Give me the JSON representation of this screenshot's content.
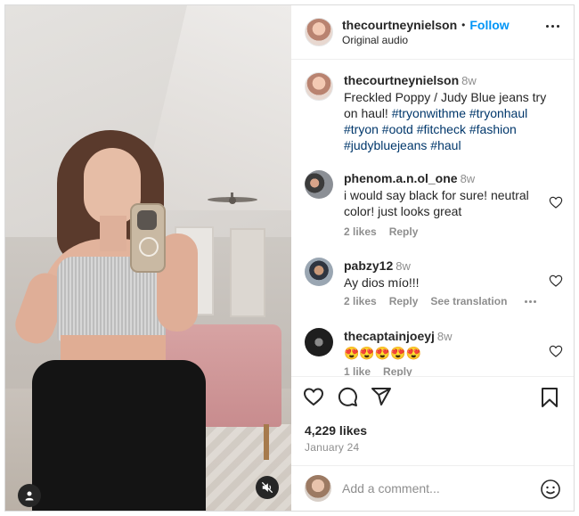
{
  "post": {
    "author": "thecourtneynielson",
    "separator": "•",
    "follow_label": "Follow",
    "audio": "Original audio"
  },
  "caption": {
    "username": "thecourtneynielson",
    "time": "8w",
    "text": "Freckled Poppy / Judy Blue jeans try on haul!",
    "hashtags": "#tryonwithme #tryonhaul #tryon #ootd #fitcheck #fashion #judybluejeans #haul"
  },
  "comments": [
    {
      "username": "phenom.a.n.ol_one",
      "time": "8w",
      "text": "i would say black for sure! neutral color! just looks great",
      "likes": "2 likes",
      "reply": "Reply"
    },
    {
      "username": "pabzy12",
      "time": "8w",
      "text": "Ay dios mío!!!",
      "likes": "2 likes",
      "reply": "Reply",
      "translate": "See translation"
    },
    {
      "username": "thecaptainjoeyj",
      "time": "8w",
      "text": "😍😍😍😍😍",
      "likes": "1 like",
      "reply": "Reply"
    }
  ],
  "actions": {
    "likes": "4,229 likes",
    "date": "January 24"
  },
  "composer": {
    "placeholder": "Add a comment..."
  },
  "colors": {
    "accent": "#0095f6",
    "hashtag": "#00376b",
    "muted": "#8e8e8e"
  }
}
